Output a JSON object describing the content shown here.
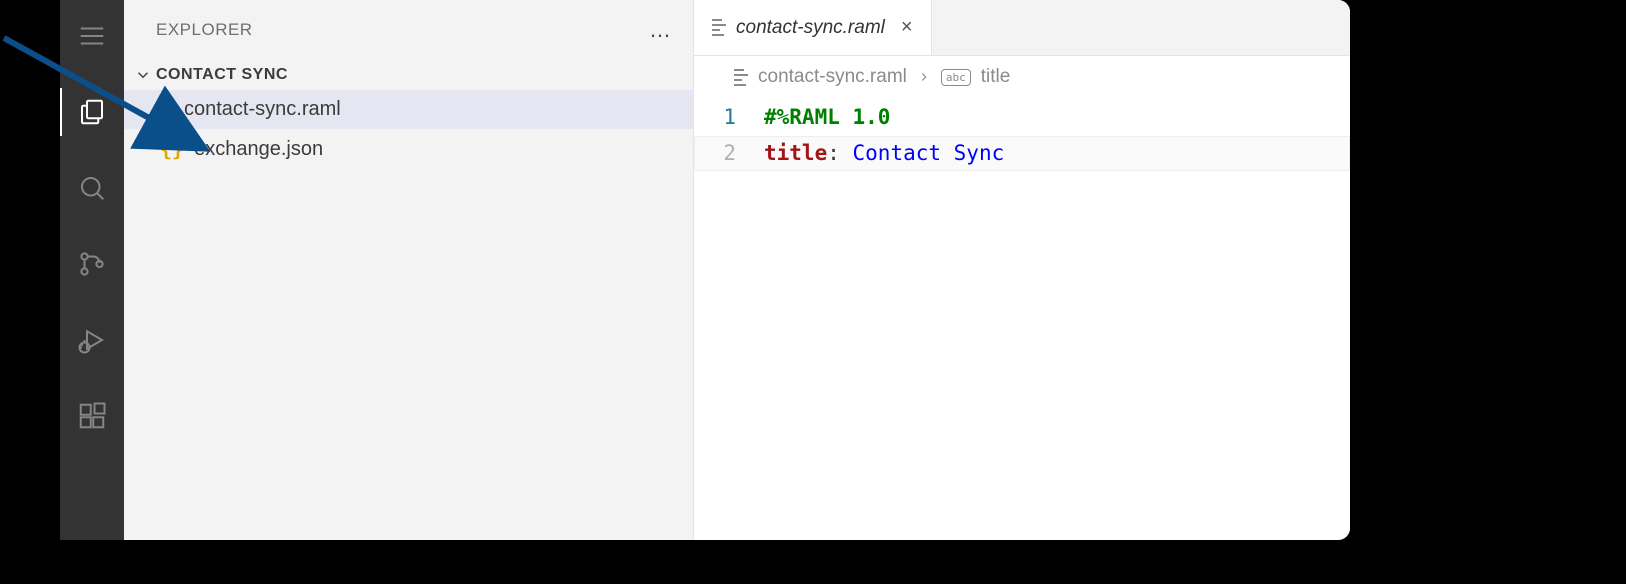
{
  "sidebar": {
    "title": "EXPLORER",
    "more": "…",
    "folder": "CONTACT SYNC",
    "files": [
      {
        "name": "contact-sync.raml",
        "icon": "lines",
        "selected": true
      },
      {
        "name": "exchange.json",
        "icon": "braces",
        "selected": false
      }
    ]
  },
  "tab": {
    "label": "contact-sync.raml"
  },
  "breadcrumb": {
    "file": "contact-sync.raml",
    "symbol": "title"
  },
  "code": {
    "lines": [
      {
        "n": "1",
        "raw": "#%RAML 1.0"
      },
      {
        "n": "2",
        "key": "title",
        "colon": ": ",
        "value": "Contact Sync"
      }
    ]
  },
  "icons": {
    "braces": "{}"
  }
}
